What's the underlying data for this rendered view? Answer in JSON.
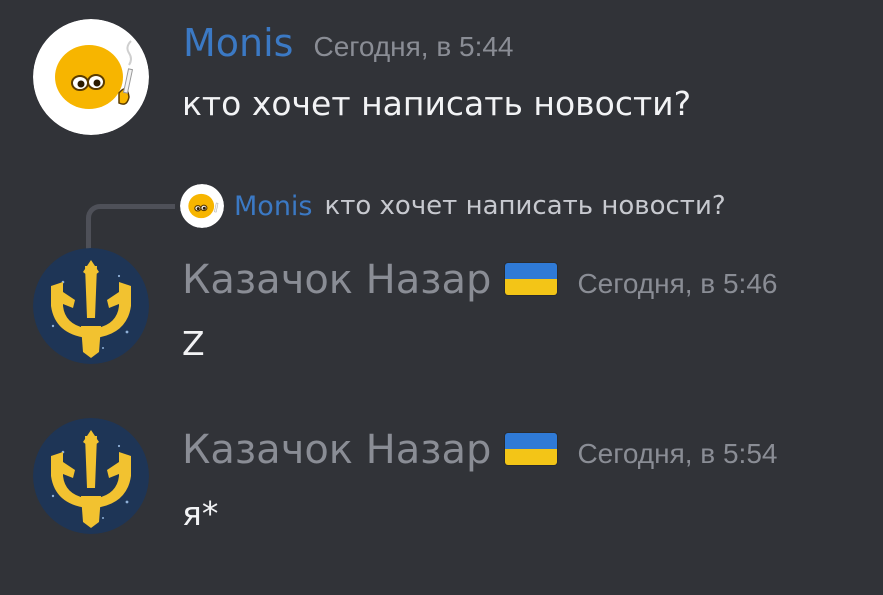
{
  "messages": [
    {
      "author": "Monis",
      "timestamp": "Сегодня, в 5:44",
      "content": "кто хочет написать новости?"
    },
    {
      "author": "Казачок Назар",
      "timestamp": "Сегодня, в 5:46",
      "content": "Z",
      "reply": {
        "author": "Monis",
        "content": "кто хочет написать новости?"
      },
      "badge": "ukraine-flag-icon"
    },
    {
      "author": "Казачок Назар",
      "timestamp": "Сегодня, в 5:54",
      "content": "я*",
      "badge": "ukraine-flag-icon"
    }
  ],
  "colors": {
    "background": "#313338",
    "monis_name": "#3b79c4",
    "nazar_name": "#8a8d95",
    "timestamp": "#8a8d95",
    "message_text": "#f2f3f5",
    "flag_blue": "#2f7ad6",
    "flag_yellow": "#f3c517"
  }
}
